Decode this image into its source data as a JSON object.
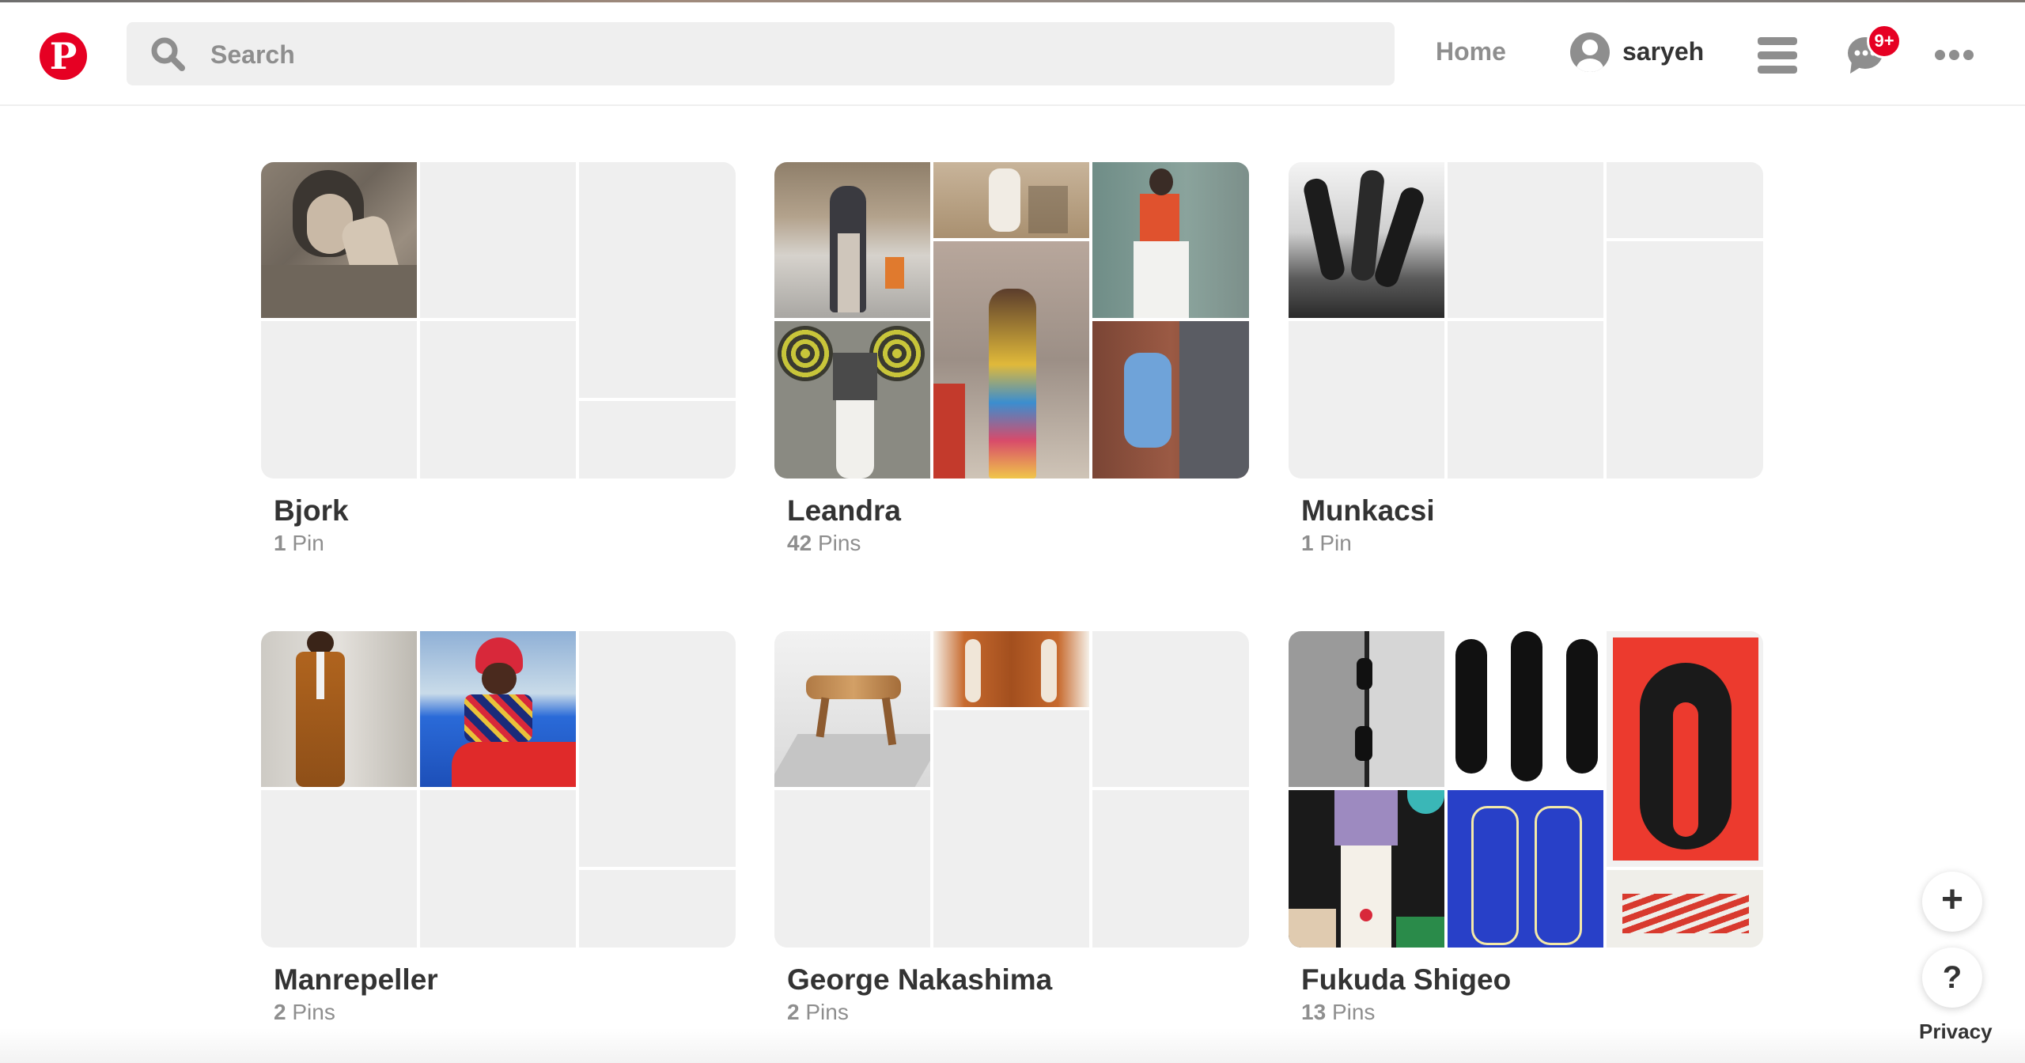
{
  "header": {
    "logo_letter": "P",
    "search_placeholder": "Search",
    "nav_home": "Home",
    "username": "saryeh",
    "notification_badge": "9+"
  },
  "boards": [
    {
      "title": "Bjork",
      "count_number": "1",
      "count_unit": "Pin"
    },
    {
      "title": "Leandra",
      "count_number": "42",
      "count_unit": "Pins"
    },
    {
      "title": "Munkacsi",
      "count_number": "1",
      "count_unit": "Pin"
    },
    {
      "title": "Manrepeller",
      "count_number": "2",
      "count_unit": "Pins"
    },
    {
      "title": "George Nakashima",
      "count_number": "2",
      "count_unit": "Pins"
    },
    {
      "title": "Fukuda Shigeo",
      "count_number": "13",
      "count_unit": "Pins"
    }
  ],
  "floating": {
    "plus_label": "+",
    "help_label": "?",
    "privacy_label": "Privacy"
  },
  "colors": {
    "brand": "#e60023",
    "placeholder_tile": "#efefef",
    "muted_text": "#8e8e8e"
  }
}
